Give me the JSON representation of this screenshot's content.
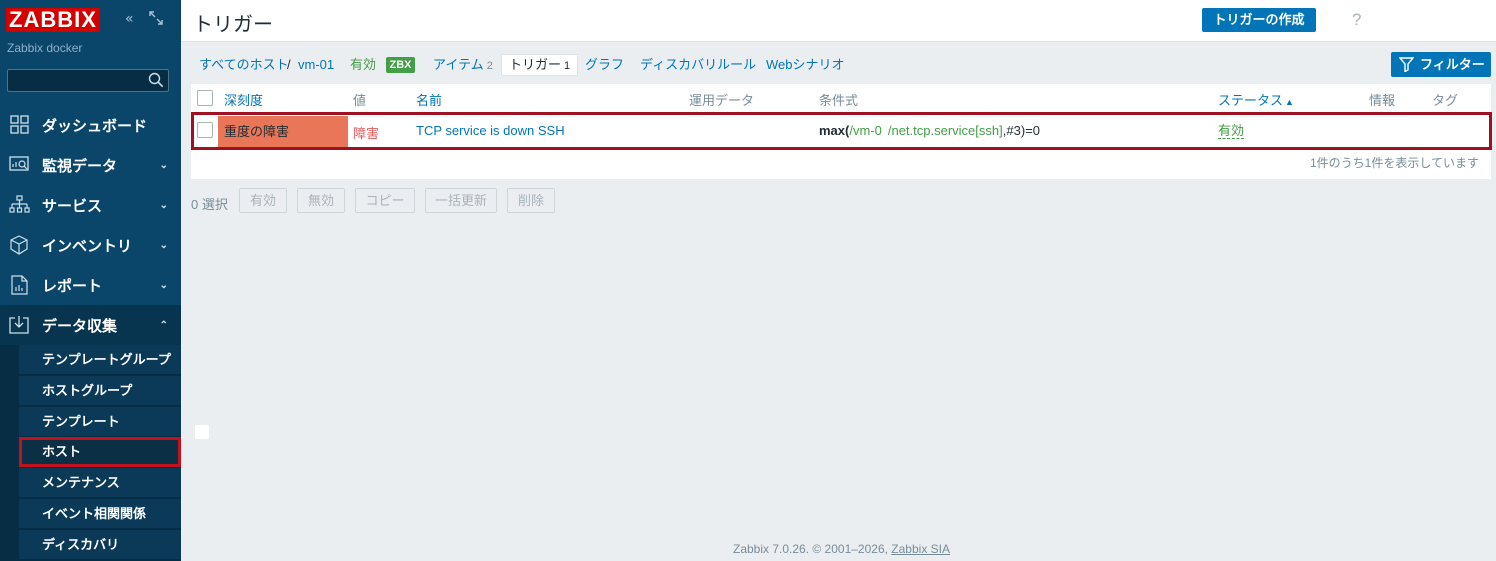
{
  "sidebar": {
    "logo": "ZABBIX",
    "subtitle": "Zabbix docker",
    "collapse_icon": "collapse-icon",
    "kiosk_icon": "kiosk-icon",
    "menu": [
      {
        "label": "ダッシュボード",
        "icon": "dashboard-icon"
      },
      {
        "label": "監視データ",
        "icon": "monitoring-icon"
      },
      {
        "label": "サービス",
        "icon": "services-icon"
      },
      {
        "label": "インベントリ",
        "icon": "inventory-icon"
      },
      {
        "label": "レポート",
        "icon": "reports-icon"
      },
      {
        "label": "データ収集",
        "icon": "data-collection-icon"
      }
    ],
    "submenu": [
      "テンプレートグループ",
      "ホストグループ",
      "テンプレート",
      "ホスト",
      "メンテナンス",
      "イベント相関関係",
      "ディスカバリ"
    ]
  },
  "header": {
    "title": "トリガー",
    "help": "?",
    "create_button": "トリガーの作成"
  },
  "nav": {
    "all_hosts": "すべてのホスト",
    "separator": "/",
    "host": "vm-01",
    "status": "有効",
    "zbx": "ZBX",
    "items": "アイテム",
    "items_count": "2",
    "triggers": "トリガー",
    "triggers_count": "1",
    "graphs": "グラフ",
    "discovery": "ディスカバリルール",
    "web": "Webシナリオ",
    "filter_button": "フィルター"
  },
  "table": {
    "headers": {
      "severity": "深刻度",
      "value": "値",
      "name": "名前",
      "operational_data": "運用データ",
      "expression": "条件式",
      "status": "ステータス",
      "info": "情報",
      "tags": "タグ"
    },
    "rows": [
      {
        "severity": "重度の障害",
        "value": "障害",
        "name": "TCP service is down SSH",
        "expr_func": "max(",
        "expr_host": "/vm-0",
        "expr_key": "/net.tcp.service[ssh]",
        "expr_tail": ",#3)=0",
        "status": "有効"
      }
    ],
    "footer": "1件のうち1件を表示しています"
  },
  "actions": {
    "selected": "0 選択",
    "enable": "有効",
    "disable": "無効",
    "copy": "コピー",
    "mass_update": "一括更新",
    "delete": "削除"
  },
  "footer": {
    "text": "Zabbix 7.0.26. © 2001–2026, ",
    "link": "Zabbix SIA"
  },
  "colors": {
    "sidebar": "#0a466a",
    "primary": "#0275b8",
    "severity_high": "#e97659",
    "problem_red": "#e45959",
    "enabled_green": "#429e47",
    "highlight_outline": "#a01020"
  }
}
